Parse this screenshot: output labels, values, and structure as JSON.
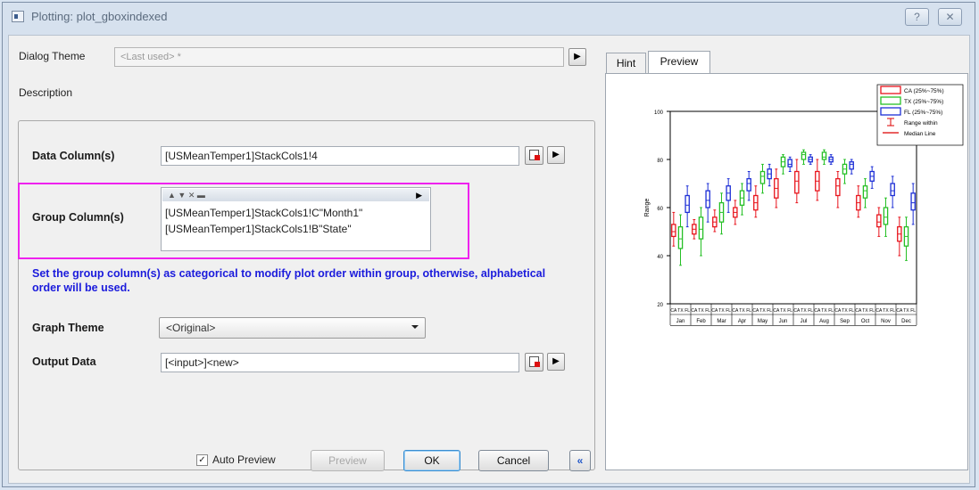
{
  "window": {
    "title": "Plotting: plot_gboxindexed",
    "help_label": "?",
    "close_label": "✕"
  },
  "dialog_theme": {
    "label": "Dialog Theme",
    "value": "<Last used> *",
    "menu_arrow": "▶"
  },
  "description_label": "Description",
  "data_columns": {
    "label": "Data Column(s)",
    "value": "[USMeanTemper1]StackCols1!4"
  },
  "group_columns": {
    "label": "Group Column(s)",
    "toolbar": "▲ ▼ ✕ ▬",
    "items": [
      "[USMeanTemper1]StackCols1!C\"Month1\"",
      "[USMeanTemper1]StackCols1!B\"State\""
    ]
  },
  "group_note": "Set the group column(s) as categorical to modify plot order within group, otherwise, alphabetical order will be used.",
  "graph_theme": {
    "label": "Graph Theme",
    "value": "<Original>"
  },
  "output_data": {
    "label": "Output Data",
    "value": "[<input>]<new>"
  },
  "buttons": {
    "auto_preview": "Auto Preview",
    "auto_preview_checked": "✓",
    "preview": "Preview",
    "ok": "OK",
    "cancel": "Cancel",
    "collapse": "«"
  },
  "tabs": [
    "Hint",
    "Preview"
  ],
  "chart_data": {
    "type": "box",
    "xlabel": "",
    "ylabel": "Range",
    "ylim": [
      20,
      100
    ],
    "yticks": [
      20,
      40,
      60,
      80,
      100
    ],
    "categories": [
      "Jan",
      "Feb",
      "Mar",
      "Apr",
      "May",
      "Jun",
      "Jul",
      "Aug",
      "Sep",
      "Oct",
      "Nov",
      "Dec"
    ],
    "series": [
      {
        "name": "CA (25%~75%)",
        "color": "#e8141c",
        "boxes": [
          [
            44,
            48,
            50,
            53,
            58
          ],
          [
            47,
            49,
            51,
            53,
            55
          ],
          [
            50,
            52,
            54,
            56,
            59
          ],
          [
            53,
            56,
            58,
            60,
            63
          ],
          [
            56,
            59,
            62,
            65,
            69
          ],
          [
            60,
            64,
            68,
            72,
            76
          ],
          [
            62,
            66,
            71,
            75,
            80
          ],
          [
            63,
            67,
            71,
            75,
            80
          ],
          [
            60,
            65,
            69,
            72,
            75
          ],
          [
            56,
            59,
            62,
            65,
            69
          ],
          [
            48,
            52,
            54,
            57,
            60
          ],
          [
            40,
            46,
            49,
            52,
            56
          ]
        ]
      },
      {
        "name": "TX (25%~75%)",
        "color": "#26c026",
        "boxes": [
          [
            36,
            43,
            47,
            52,
            57
          ],
          [
            40,
            47,
            51,
            56,
            60
          ],
          [
            49,
            54,
            58,
            62,
            66
          ],
          [
            57,
            61,
            64,
            67,
            70
          ],
          [
            66,
            70,
            73,
            75,
            78
          ],
          [
            74,
            77,
            79,
            81,
            82
          ],
          [
            78,
            80,
            82,
            83,
            84
          ],
          [
            78,
            80,
            81,
            83,
            84
          ],
          [
            70,
            74,
            76,
            78,
            80
          ],
          [
            60,
            64,
            67,
            69,
            72
          ],
          [
            48,
            53,
            56,
            60,
            64
          ],
          [
            38,
            44,
            48,
            52,
            56
          ]
        ]
      },
      {
        "name": "FL (25%~75%)",
        "color": "#1d2fd6",
        "boxes": [
          [
            52,
            58,
            61,
            65,
            69
          ],
          [
            54,
            60,
            63,
            67,
            70
          ],
          [
            58,
            63,
            66,
            69,
            72
          ],
          [
            63,
            67,
            70,
            72,
            75
          ],
          [
            69,
            72,
            74,
            76,
            78
          ],
          [
            75,
            77,
            78,
            80,
            81
          ],
          [
            78,
            79,
            80,
            81,
            82
          ],
          [
            78,
            79,
            80,
            81,
            82
          ],
          [
            74,
            76,
            78,
            79,
            80
          ],
          [
            68,
            71,
            73,
            75,
            77
          ],
          [
            60,
            65,
            67,
            70,
            73
          ],
          [
            53,
            59,
            62,
            66,
            70
          ]
        ]
      }
    ],
    "legend": [
      "CA (25%~75%)",
      "TX (25%~75%)",
      "FL (25%~75%)",
      "Range within",
      "Median Line"
    ],
    "legend_position": "top-right",
    "x_sub_labels": [
      "CA",
      "TX",
      "FL"
    ]
  }
}
